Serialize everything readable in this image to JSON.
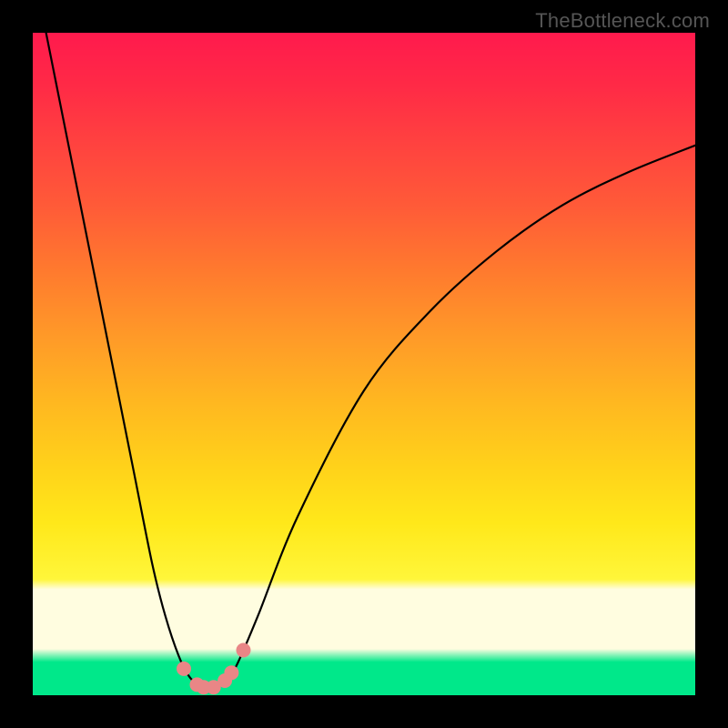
{
  "attribution": "TheBottleneck.com",
  "colors": {
    "page_bg": "#000000",
    "gradient_top": "#ff1a4d",
    "gradient_mid_orange": "#ff7a2e",
    "gradient_yellow": "#ffe81a",
    "gradient_pale": "#fffde0",
    "gradient_green": "#00e88a",
    "curve_stroke": "#000000",
    "marker_fill": "#e98686",
    "marker_stroke": "#c85a5a"
  },
  "chart_data": {
    "type": "line",
    "title": "",
    "xlabel": "",
    "ylabel": "",
    "xlim": [
      0,
      100
    ],
    "ylim": [
      0,
      100
    ],
    "grid": false,
    "legend": false,
    "series": [
      {
        "name": "bottleneck-curve",
        "x": [
          2,
          5,
          10,
          15,
          18,
          20,
          22,
          23.5,
          25,
          26.5,
          28,
          29.5,
          31,
          34,
          40,
          50,
          60,
          70,
          80,
          90,
          100
        ],
        "y": [
          100,
          85,
          60,
          35,
          20,
          12,
          6,
          3,
          1.5,
          1,
          1.5,
          2.5,
          5,
          12,
          27,
          46,
          58,
          67,
          74,
          79,
          83
        ]
      }
    ],
    "markers": {
      "name": "highlight-points",
      "x": [
        22.8,
        24.8,
        25.8,
        27.3,
        29.0,
        30.0,
        31.8
      ],
      "y": [
        4.0,
        1.6,
        1.2,
        1.2,
        2.2,
        3.4,
        6.8
      ]
    }
  }
}
